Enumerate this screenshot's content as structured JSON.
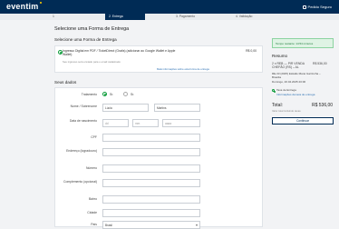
{
  "header": {
    "logo": "eventim",
    "secure_label": "Pedido Seguro"
  },
  "steps": [
    {
      "label": "1",
      "active": false
    },
    {
      "label": "2. Entrega",
      "active": true
    },
    {
      "label": "3. Pagamento",
      "active": false
    },
    {
      "label": "4. Validação",
      "active": false
    }
  ],
  "main": {
    "title": "Selecione uma Forma de Entrega",
    "subtitle": "Selecione uma Forma de Entrega",
    "delivery_option": {
      "text": "Ingresso Digital em PDF / TicketDirect (Gratis) (adicionar ao Google Wallet e Apple Wallet)",
      "price": "R$ 0,00",
      "note": "Seu ingresso será enviado para o email cadastrado",
      "link": "Mais informações sobre esta forma de entrega"
    },
    "personal_title": "Seus dados",
    "form": {
      "salutation_label": "Tratamento",
      "salutation_sr": "Sr.",
      "salutation_sra": "Sr.",
      "name_label": "Nome / Sobrenome",
      "first_name_value": "Lúcia",
      "last_name_value": "Martins",
      "birth_label": "Data de nascimento",
      "birth_day": "dd",
      "birth_month": "mm",
      "birth_year": "aaaa",
      "cpf_label": "CPF",
      "address_label": "Endereço (logradouro)",
      "number_label": "Número",
      "complement_label": "Complemento (opcional)",
      "district_label": "Bairro",
      "city_label": "Cidade",
      "country_label": "País",
      "country_value": "Brasil"
    }
  },
  "summary": {
    "alert": "Tempo restante: 14:54 minutos",
    "title": "Resumo",
    "line1": "2 x REB — PIR VENDA CHEFÃO (RS) – AL",
    "line1_price": "R$ 536,00",
    "line2": "RE-33 (2025) Estádio Mané Garrincha – Brasília",
    "line3": "Domingo, 20.04.2025 20:00",
    "fee_label": "Taxa de Entrega",
    "fee_link": "Informações da taxa de entrega",
    "total_label": "Total:",
    "total_value": "R$ 536,00",
    "total_note": "Valor total incluindo taxas",
    "pay_button": "Continuar"
  }
}
